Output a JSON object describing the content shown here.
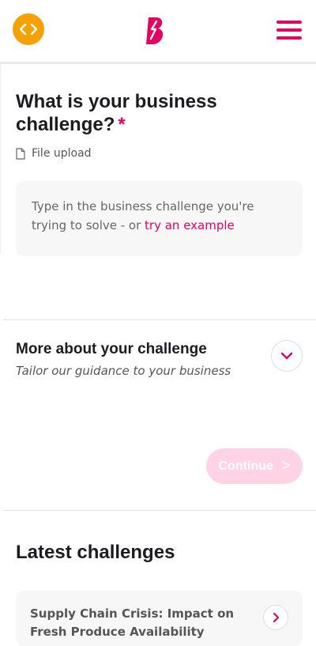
{
  "header": {
    "code_icon": "code-brackets-icon",
    "logo_icon": "brand-b-logo",
    "menu_icon": "hamburger-menu-icon"
  },
  "challenge": {
    "title": "What is your business challenge?",
    "required_mark": "*",
    "file_upload_label": "File upload",
    "input_placeholder": "Type in the business challenge you're trying to solve - or ",
    "example_link": "try an example"
  },
  "more": {
    "title": "More about your challenge",
    "subtitle": "Tailor our guidance to your business"
  },
  "continue_label": "Continue",
  "latest": {
    "title": "Latest challenges",
    "cards": [
      {
        "title": "Supply Chain Crisis: Impact on Fresh Produce Availability"
      }
    ]
  },
  "colors": {
    "brand_pink": "#e6005f",
    "orange": "#f5a100",
    "disabled_pink": "#ffd2e4"
  }
}
